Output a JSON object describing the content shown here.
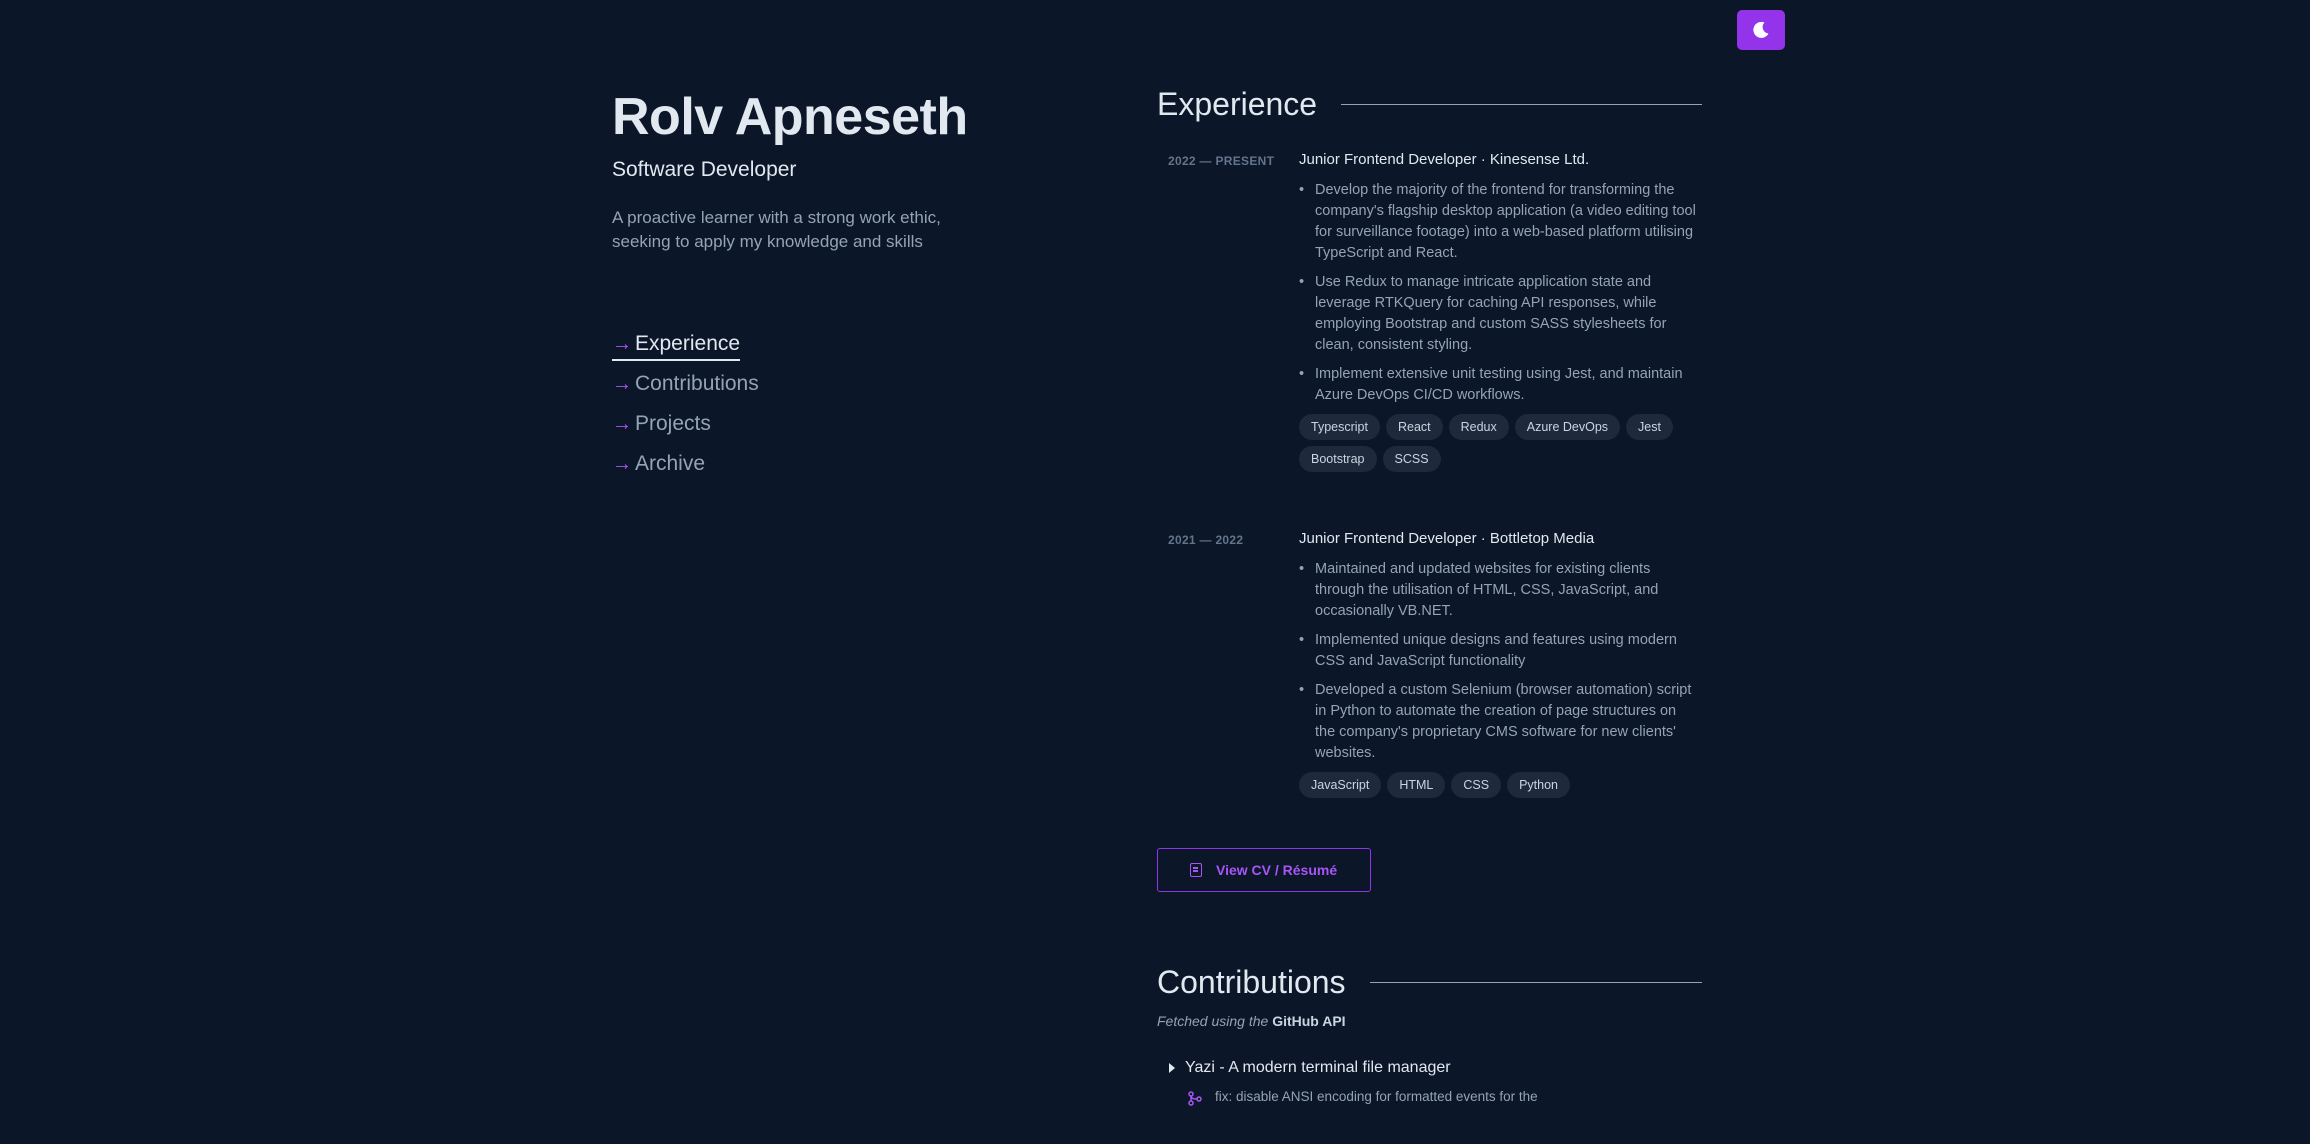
{
  "theme_toggle": {
    "icon": "moon-icon"
  },
  "profile": {
    "name": "Rolv Apneseth",
    "role": "Software Developer",
    "bio": "A proactive learner with a strong work ethic, seeking to apply my knowledge and skills"
  },
  "nav": {
    "items": [
      {
        "label": "Experience",
        "active": true
      },
      {
        "label": "Contributions"
      },
      {
        "label": "Projects"
      },
      {
        "label": "Archive"
      }
    ]
  },
  "experience": {
    "title": "Experience",
    "jobs": [
      {
        "date": "2022 — PRESENT",
        "title": "Junior Frontend Developer · Kinesense Ltd.",
        "bullets": [
          "Develop the majority of the frontend for transforming the company's flagship desktop application (a video editing tool for surveillance footage) into a web-based platform utilising TypeScript and React.",
          "Use Redux to manage intricate application state and leverage RTKQuery for caching API responses, while employing Bootstrap and custom SASS stylesheets for clean, consistent styling.",
          "Implement extensive unit testing using Jest, and maintain Azure DevOps CI/CD workflows."
        ],
        "tags": [
          "Typescript",
          "React",
          "Redux",
          "Azure DevOps",
          "Jest",
          "Bootstrap",
          "SCSS"
        ]
      },
      {
        "date": "2021 — 2022",
        "title": "Junior Frontend Developer · Bottletop Media",
        "bullets": [
          "Maintained and updated websites for existing clients through the utilisation of HTML, CSS, JavaScript, and occasionally VB.NET.",
          "Implemented unique designs and features using modern CSS and JavaScript functionality",
          "Developed a custom Selenium (browser automation) script in Python to automate the creation of page structures on the company's proprietary CMS software for new clients' websites."
        ],
        "tags": [
          "JavaScript",
          "HTML",
          "CSS",
          "Python"
        ]
      }
    ],
    "cv_button": "View CV / Résumé"
  },
  "contributions": {
    "title": "Contributions",
    "fetched_prefix": "Fetched using the",
    "fetched_source": "GitHub API",
    "repos": [
      {
        "name": "Yazi - A modern terminal file manager",
        "commit": "fix: disable ANSI encoding for formatted events for the"
      }
    ]
  },
  "colors": {
    "background": "#0b1628",
    "accent": "#9333ea",
    "text": "#e2e8f0",
    "muted": "#94a3b8"
  }
}
